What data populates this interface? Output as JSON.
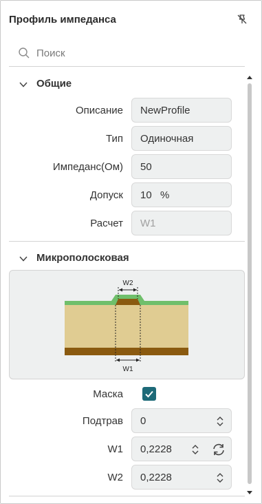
{
  "header": {
    "title": "Профиль импеданса",
    "pin_icon": "pin-off-icon"
  },
  "search": {
    "placeholder": "Поиск",
    "icon": "search-icon"
  },
  "sections": {
    "general": {
      "title": "Общие",
      "fields": {
        "description": {
          "label": "Описание",
          "value": "NewProfile"
        },
        "type": {
          "label": "Тип",
          "value": "Одиночная"
        },
        "impedance": {
          "label": "Импеданс(Ом)",
          "value": "50"
        },
        "tolerance": {
          "label": "Допуск",
          "value": "10",
          "unit": "%"
        },
        "calc": {
          "label": "Расчет",
          "value": "W1"
        }
      }
    },
    "microstrip": {
      "title": "Микрополосковая",
      "diagram": {
        "w2_label": "W2",
        "w1_label": "W1"
      },
      "mask": {
        "label": "Маска",
        "checked": true
      },
      "undercut": {
        "label": "Подтрав",
        "value": "0"
      },
      "w1": {
        "label": "W1",
        "value": "0,2228"
      },
      "w2": {
        "label": "W2",
        "value": "0,2228"
      }
    }
  },
  "colors": {
    "accent": "#1d6a78",
    "dielectric": "#e0cc92",
    "copper": "#8a5a10",
    "mask": "#6fbf6b",
    "field_bg": "#eef0f0"
  }
}
